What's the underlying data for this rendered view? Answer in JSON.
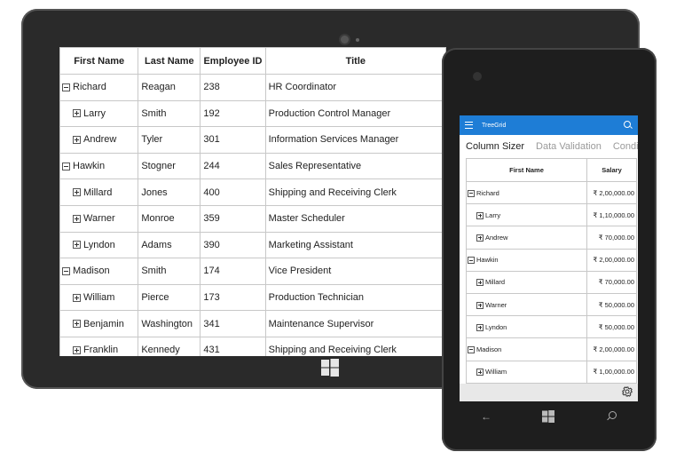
{
  "tablet": {
    "columns": [
      "First Name",
      "Last Name",
      "Employee ID",
      "Title"
    ],
    "rows": [
      {
        "expander": "minus",
        "level": 0,
        "first": "Richard",
        "last": "Reagan",
        "id": "238",
        "title": "HR Coordinator"
      },
      {
        "expander": "plus",
        "level": 1,
        "first": "Larry",
        "last": "Smith",
        "id": "192",
        "title": "Production Control Manager"
      },
      {
        "expander": "plus",
        "level": 1,
        "first": "Andrew",
        "last": "Tyler",
        "id": "301",
        "title": "Information Services Manager"
      },
      {
        "expander": "minus",
        "level": 0,
        "first": "Hawkin",
        "last": "Stogner",
        "id": "244",
        "title": "Sales Representative"
      },
      {
        "expander": "plus",
        "level": 1,
        "first": "Millard",
        "last": "Jones",
        "id": "400",
        "title": "Shipping and Receiving Clerk"
      },
      {
        "expander": "plus",
        "level": 1,
        "first": "Warner",
        "last": "Monroe",
        "id": "359",
        "title": "Master Scheduler"
      },
      {
        "expander": "plus",
        "level": 1,
        "first": "Lyndon",
        "last": "Adams",
        "id": "390",
        "title": "Marketing Assistant"
      },
      {
        "expander": "minus",
        "level": 0,
        "first": "Madison",
        "last": "Smith",
        "id": "174",
        "title": "Vice President"
      },
      {
        "expander": "plus",
        "level": 1,
        "first": "William",
        "last": "Pierce",
        "id": "173",
        "title": "Production Technician"
      },
      {
        "expander": "plus",
        "level": 1,
        "first": "Benjamin",
        "last": "Washington",
        "id": "341",
        "title": "Maintenance Supervisor"
      },
      {
        "expander": "plus",
        "level": 1,
        "first": "Franklin",
        "last": "Kennedy",
        "id": "431",
        "title": "Shipping and Receiving Clerk"
      }
    ]
  },
  "phone": {
    "app_title": "TreeGrid",
    "tabs": [
      "Column Sizer",
      "Data Validation",
      "Conditi"
    ],
    "columns": [
      "First Name",
      "Salary"
    ],
    "rows": [
      {
        "expander": "minus",
        "level": 0,
        "first": "Richard",
        "salary": "₹ 2,00,000.00"
      },
      {
        "expander": "plus",
        "level": 1,
        "first": "Larry",
        "salary": "₹ 1,10,000.00"
      },
      {
        "expander": "plus",
        "level": 1,
        "first": "Andrew",
        "salary": "₹ 70,000.00"
      },
      {
        "expander": "minus",
        "level": 0,
        "first": "Hawkin",
        "salary": "₹ 2,00,000.00"
      },
      {
        "expander": "plus",
        "level": 1,
        "first": "Millard",
        "salary": "₹ 70,000.00"
      },
      {
        "expander": "plus",
        "level": 1,
        "first": "Warner",
        "salary": "₹ 50,000.00"
      },
      {
        "expander": "plus",
        "level": 1,
        "first": "Lyndon",
        "salary": "₹ 50,000.00"
      },
      {
        "expander": "minus",
        "level": 0,
        "first": "Madison",
        "salary": "₹ 2,00,000.00"
      },
      {
        "expander": "plus",
        "level": 1,
        "first": "William",
        "salary": "₹ 1,00,000.00"
      }
    ]
  },
  "icons": {
    "expand": "plus-box-icon",
    "collapse": "minus-box-icon",
    "menu": "hamburger-icon",
    "search": "search-icon",
    "settings": "gear-icon",
    "windows": "windows-logo-icon",
    "back": "back-arrow-icon"
  },
  "colors": {
    "appbar": "#1e7dd6",
    "device": "#2a2a2a",
    "grid_border": "#c8c8c8"
  }
}
